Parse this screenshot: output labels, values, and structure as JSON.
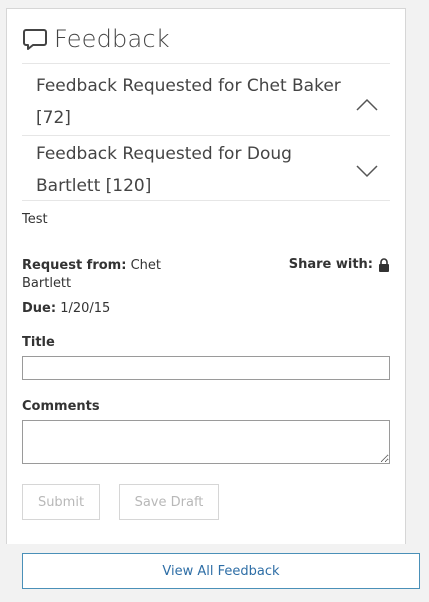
{
  "panel": {
    "title": "Feedback",
    "title_icon": "speech-bubble-icon"
  },
  "accordions": [
    {
      "title": "Feedback Requested for Chet Baker [72]",
      "state": "expanded",
      "icon": "chevron-up-icon"
    },
    {
      "title": "Feedback Requested for Doug Bartlett [120]",
      "state": "collapsed",
      "icon": "chevron-down-icon"
    }
  ],
  "detail": {
    "description": "Test",
    "request_from_label": "Request from:",
    "request_from_value": "Chet Bartlett",
    "share_with_label": "Share with:",
    "share_icon": "lock-icon",
    "due_label": "Due:",
    "due_value": "1/20/15"
  },
  "form": {
    "title_label": "Title",
    "title_value": "",
    "comments_label": "Comments",
    "comments_value": "",
    "submit_label": "Submit",
    "save_draft_label": "Save Draft"
  },
  "footer": {
    "view_all_label": "View All Feedback"
  },
  "colors": {
    "link": "#2e6ea6",
    "border": "#d6d6d6",
    "disabled_text": "#b8b8b8"
  }
}
